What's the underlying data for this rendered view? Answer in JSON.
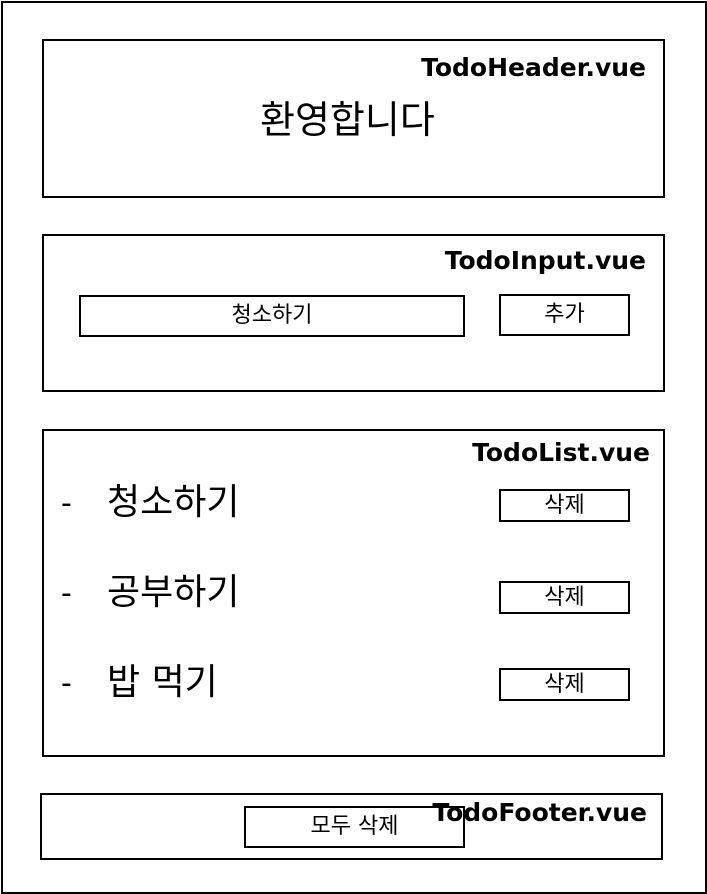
{
  "header": {
    "component": "TodoHeader.vue",
    "welcome": "환영합니다"
  },
  "input": {
    "component": "TodoInput.vue",
    "value": "청소하기",
    "add_label": "추가"
  },
  "list": {
    "component": "TodoList.vue",
    "bullet": "-",
    "items": [
      {
        "text": "청소하기",
        "delete_label": "삭제"
      },
      {
        "text": "공부하기",
        "delete_label": "삭제"
      },
      {
        "text": "밥 먹기",
        "delete_label": "삭제"
      }
    ]
  },
  "footer": {
    "component": "TodoFooter.vue",
    "clear_label": "모두 삭제"
  }
}
